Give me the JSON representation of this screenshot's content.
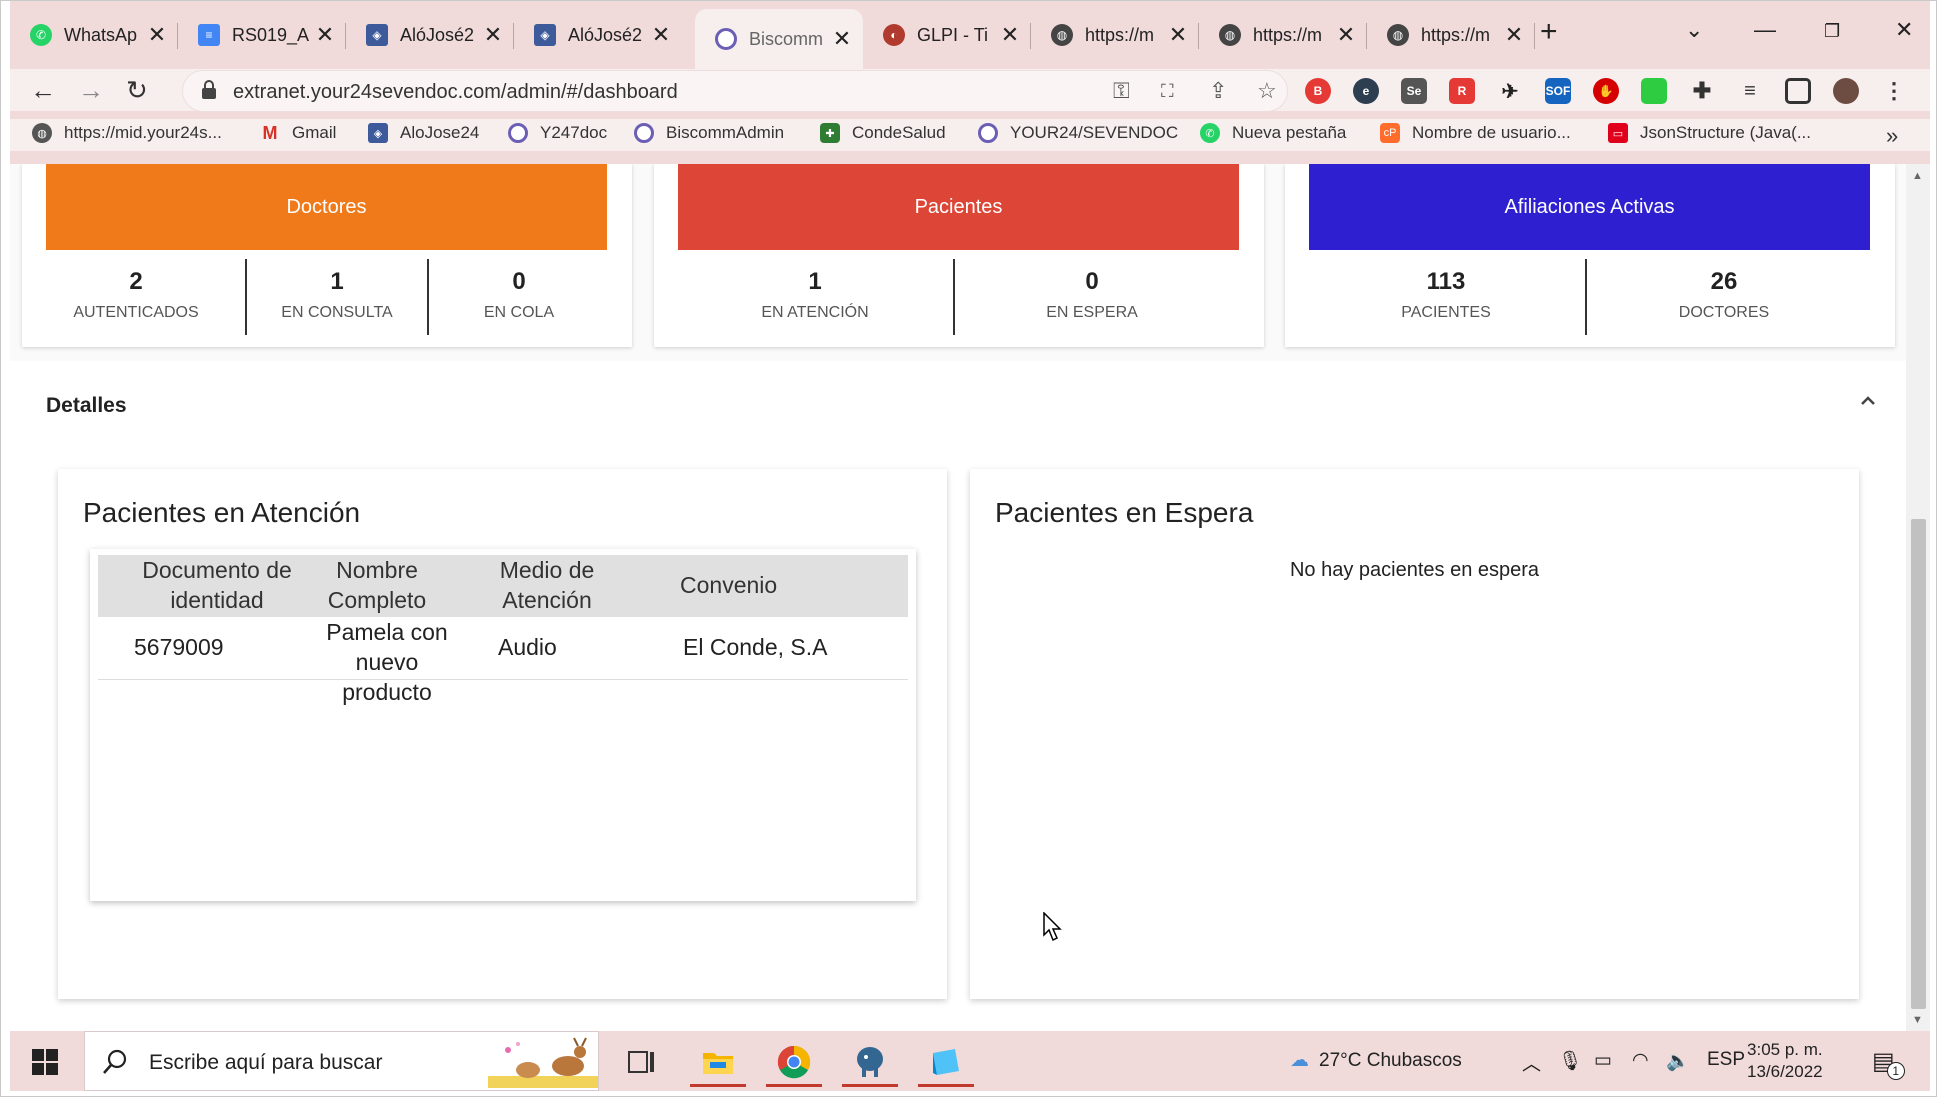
{
  "browser": {
    "tabs": [
      {
        "title": "WhatsAp",
        "icon": "whatsapp-icon",
        "color": "#25d366"
      },
      {
        "title": "RS019_A",
        "icon": "docs-icon",
        "color": "#4285f4"
      },
      {
        "title": "AlóJosé2",
        "icon": "app-shield-icon",
        "color": "#3d5a9a"
      },
      {
        "title": "AlóJosé2",
        "icon": "app-shield-icon",
        "color": "#3d5a9a"
      },
      {
        "title": "Biscomm",
        "icon": "biscomm-icon",
        "color": "#6b5fb5"
      },
      {
        "title": "GLPI - Ti",
        "icon": "glpi-icon",
        "color": "#b03a2e"
      },
      {
        "title": "https://m",
        "icon": "globe-icon",
        "color": "#444444"
      },
      {
        "title": "https://m",
        "icon": "globe-icon",
        "color": "#444444"
      },
      {
        "title": "https://m",
        "icon": "globe-icon",
        "color": "#444444"
      }
    ],
    "url": "extranet.your24sevendoc.com/admin/#/dashboard",
    "bookmarks": [
      {
        "label": "https://mid.your24s...",
        "icon": "globe-icon",
        "color": "#555555"
      },
      {
        "label": "Gmail",
        "icon": "gmail-icon",
        "color": "#d93025"
      },
      {
        "label": "AloJose24",
        "icon": "app-shield-icon",
        "color": "#3d5a9a"
      },
      {
        "label": "Y247doc",
        "icon": "arc-icon",
        "color": "#6b5fb5"
      },
      {
        "label": "BiscommAdmin",
        "icon": "biscomm-icon",
        "color": "#6b5fb5"
      },
      {
        "label": "CondeSalud",
        "icon": "shield-icon",
        "color": "#2e7d32"
      },
      {
        "label": "YOUR24/SEVENDOC",
        "icon": "arc-icon",
        "color": "#6b5fb5"
      },
      {
        "label": "Nueva pestaña",
        "icon": "whatsapp-icon",
        "color": "#25d366"
      },
      {
        "label": "Nombre de usuario...",
        "icon": "cpanel-icon",
        "color": "#ff6c2c"
      },
      {
        "label": "JsonStructure (Java(...",
        "icon": "oracle-icon",
        "color": "#e0001b"
      }
    ]
  },
  "dashboard": {
    "cards": [
      {
        "title": "Doctores",
        "color": "#f07a1a",
        "stats": [
          {
            "value": "2",
            "label": "AUTENTICADOS"
          },
          {
            "value": "1",
            "label": "EN CONSULTA"
          },
          {
            "value": "0",
            "label": "EN COLA"
          }
        ]
      },
      {
        "title": "Pacientes",
        "color": "#dd4637",
        "stats": [
          {
            "value": "1",
            "label": "EN ATENCIÓN"
          },
          {
            "value": "0",
            "label": "EN ESPERA"
          }
        ]
      },
      {
        "title": "Afiliaciones Activas",
        "color": "#2e1fd0",
        "stats": [
          {
            "value": "113",
            "label": "PACIENTES"
          },
          {
            "value": "26",
            "label": "DOCTORES"
          }
        ]
      }
    ],
    "details": {
      "title": "Detalles",
      "attention": {
        "title": "Pacientes en Atención",
        "columns": [
          "Documento de identidad",
          "Nombre Completo",
          "Medio de Atención",
          "Convenio"
        ],
        "rows": [
          [
            "5679009",
            "Pamela con nuevo producto",
            "Audio",
            "El Conde, S.A"
          ]
        ]
      },
      "waiting": {
        "title": "Pacientes en Espera",
        "empty_text": "No hay pacientes en espera"
      }
    }
  },
  "taskbar": {
    "search_placeholder": "Escribe aquí para buscar",
    "weather": "27°C  Chubascos",
    "language": "ESP",
    "time": "3:05 p. m.",
    "date": "13/6/2022",
    "notifications": "1"
  }
}
